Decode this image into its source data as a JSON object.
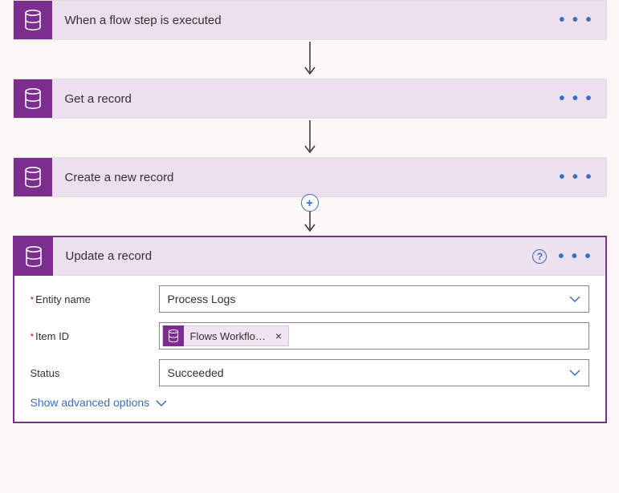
{
  "steps": [
    {
      "title": "When a flow step is executed"
    },
    {
      "title": "Get a record"
    },
    {
      "title": "Create a new record"
    },
    {
      "title": "Update a record"
    }
  ],
  "form": {
    "entityName": {
      "label": "Entity name",
      "value": "Process Logs"
    },
    "itemId": {
      "label": "Item ID",
      "tokenLabel": "Flows Workflo…"
    },
    "status": {
      "label": "Status",
      "value": "Succeeded"
    },
    "advancedLabel": "Show advanced options"
  },
  "icons": {
    "ellipsis": "• • •",
    "help": "?",
    "plus": "+",
    "close": "×"
  }
}
